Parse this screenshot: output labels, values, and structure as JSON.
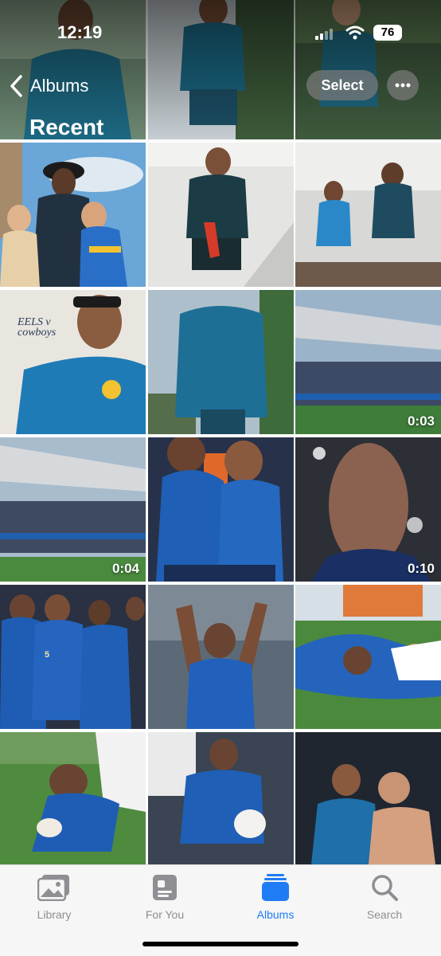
{
  "status_bar": {
    "time": "12:19",
    "battery": "76"
  },
  "nav": {
    "back_label": "Albums",
    "title": "Recent",
    "select_label": "Select"
  },
  "videos": [
    {
      "id": "stadium-1",
      "duration": "0:03"
    },
    {
      "id": "stadium-2",
      "duration": "0:04"
    },
    {
      "id": "selfie",
      "duration": "0:10"
    }
  ],
  "tile_text": {
    "eels_cowboys_line1": "EELS v",
    "eels_cowboys_line2": "cowboys"
  },
  "tabs": [
    {
      "label": "Library",
      "icon": "photo-library-icon",
      "active": false
    },
    {
      "label": "For You",
      "icon": "for-you-icon",
      "active": false
    },
    {
      "label": "Albums",
      "icon": "albums-icon",
      "active": true
    },
    {
      "label": "Search",
      "icon": "search-icon",
      "active": false
    }
  ],
  "colors": {
    "accent": "#1f7cf5",
    "inactive": "#8e8e93",
    "eels_blue": "#1f5fb5",
    "eels_gold": "#f2c230"
  }
}
